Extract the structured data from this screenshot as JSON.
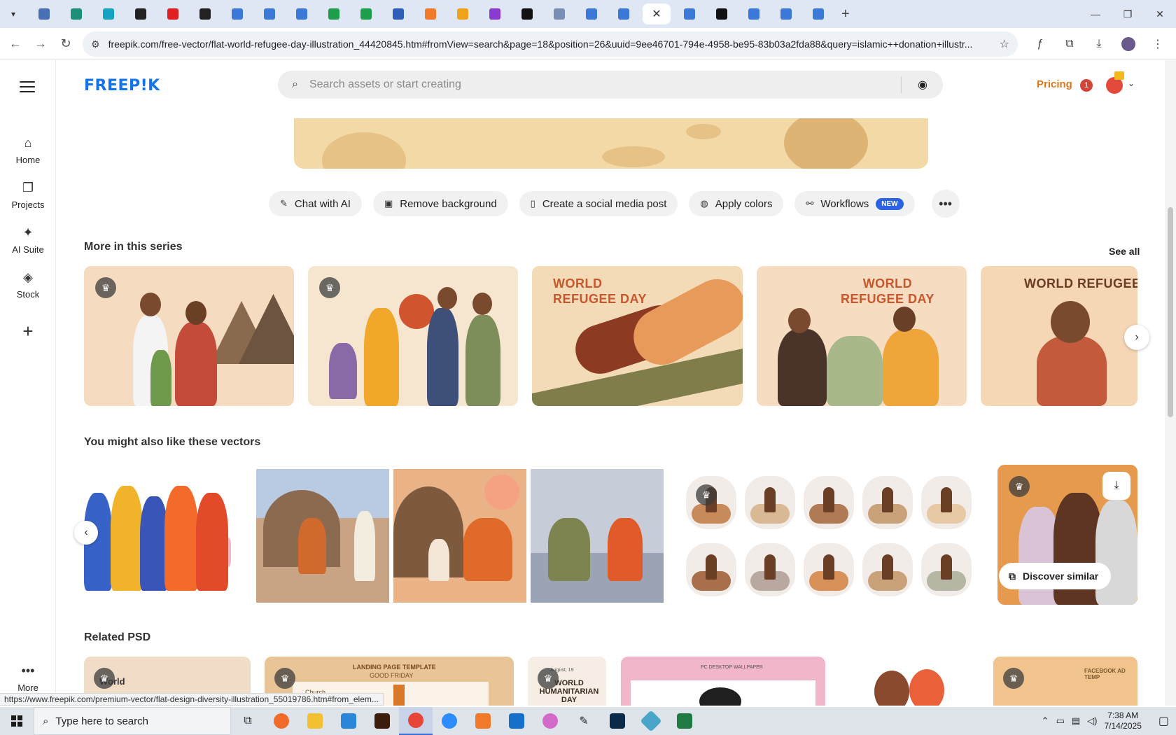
{
  "browser": {
    "tab_count_icons": [
      "edge-icon",
      "vpn-icon",
      "arrow-icon",
      "chatgpt-icon",
      "youtube-icon",
      "bolt-icon",
      "docs-icon",
      "docs-icon",
      "docs-icon",
      "sheets-icon",
      "sheets-icon",
      "word-icon",
      "xampp-icon",
      "v-icon",
      "code-icon",
      "nextjs-icon",
      "app-icon",
      "forms-icon",
      "forms-icon",
      "forms-icon",
      "medium-icon",
      "forms-icon",
      "forms-icon",
      "forms-icon"
    ],
    "active_tab_close": "✕",
    "new_tab": "+",
    "url": "freepik.com/free-vector/flat-world-refugee-day-illustration_44420845.htm#fromView=search&page=18&position=26&uuid=9ee46701-794e-4958-be95-83b03a2fda88&query=islamic++donation+illustr...",
    "status_url": "https://www.freepik.com/premium-vector/flat-design-diversity-illustration_55019786.htm#from_elem..."
  },
  "header": {
    "logo": "FREEP!K",
    "search_placeholder": "Search assets or start creating",
    "pricing": "Pricing",
    "notif_count": "1"
  },
  "sidebar": {
    "items": [
      {
        "label": "Home",
        "icon": "⌂"
      },
      {
        "label": "Projects",
        "icon": "❐"
      },
      {
        "label": "AI Suite",
        "icon": "✦"
      },
      {
        "label": "Stock",
        "icon": "◈"
      }
    ],
    "more_label": "More"
  },
  "actions": [
    {
      "label": "Chat with AI",
      "icon": "✎"
    },
    {
      "label": "Remove background",
      "icon": "▣"
    },
    {
      "label": "Create a social media post",
      "icon": "▯"
    },
    {
      "label": "Apply colors",
      "icon": "◍"
    },
    {
      "label": "Workflows",
      "icon": "⚯",
      "badge": "NEW"
    }
  ],
  "sections": {
    "series_title": "More in this series",
    "see_all": "See all",
    "vectors_title": "You might also like these vectors",
    "psd_title": "Related PSD",
    "discover": "Discover similar"
  },
  "series_cards": [
    {
      "text": ""
    },
    {
      "text": ""
    },
    {
      "text": "WORLD\nREFUGEE DAY"
    },
    {
      "text": "WORLD\nREFUGEE DAY"
    },
    {
      "text": "WORLD REFUGEE DA"
    }
  ],
  "psd_texts": {
    "card1": "World",
    "card2_title": "LANDING PAGE TEMPLATE",
    "card2_sub": "GOOD FRIDAY",
    "card2_brand": "Church",
    "card3_date": "August, 19",
    "card3_title": "WORLD HUMANITARIAN DAY",
    "card4_title": "PC DESKTOP WALLPAPER",
    "card6_title": "FACEBOOK AD TEMP"
  },
  "taskbar": {
    "search_placeholder": "Type here to search",
    "time": "7:38 AM",
    "date": "7/14/2025"
  },
  "colors": {
    "accent": "#1273eb",
    "pricing": "#d9781d",
    "badge": "#2b63e4"
  }
}
